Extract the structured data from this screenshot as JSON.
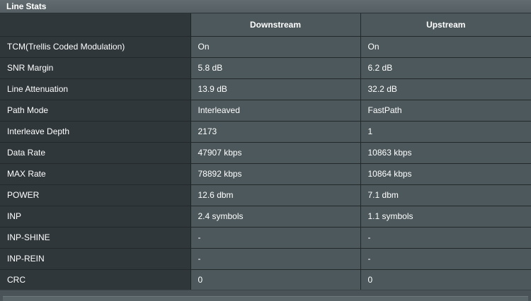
{
  "panel": {
    "title": "Line Stats"
  },
  "table": {
    "headers": [
      "",
      "Downstream",
      "Upstream"
    ],
    "rows": [
      {
        "label": "TCM(Trellis Coded Modulation)",
        "down": "On",
        "up": "On"
      },
      {
        "label": "SNR Margin",
        "down": "5.8 dB",
        "up": "6.2 dB"
      },
      {
        "label": "Line Attenuation",
        "down": "13.9 dB",
        "up": "32.2 dB"
      },
      {
        "label": "Path Mode",
        "down": "Interleaved",
        "up": "FastPath"
      },
      {
        "label": "Interleave Depth",
        "down": "2173",
        "up": "1"
      },
      {
        "label": "Data Rate",
        "down": "47907 kbps",
        "up": "10863 kbps"
      },
      {
        "label": "MAX Rate",
        "down": "78892 kbps",
        "up": "10864 kbps"
      },
      {
        "label": "POWER",
        "down": "12.6 dbm",
        "up": "7.1 dbm"
      },
      {
        "label": "INP",
        "down": "2.4 symbols",
        "up": "1.1 symbols"
      },
      {
        "label": "INP-SHINE",
        "down": "-",
        "up": "-"
      },
      {
        "label": "INP-REIN",
        "down": "-",
        "up": "-"
      },
      {
        "label": "CRC",
        "down": "0",
        "up": "0"
      }
    ]
  },
  "colors": {
    "label_column_bg": "#2f373a",
    "value_cell_bg": "#4d585c",
    "text": "#ffffff"
  }
}
